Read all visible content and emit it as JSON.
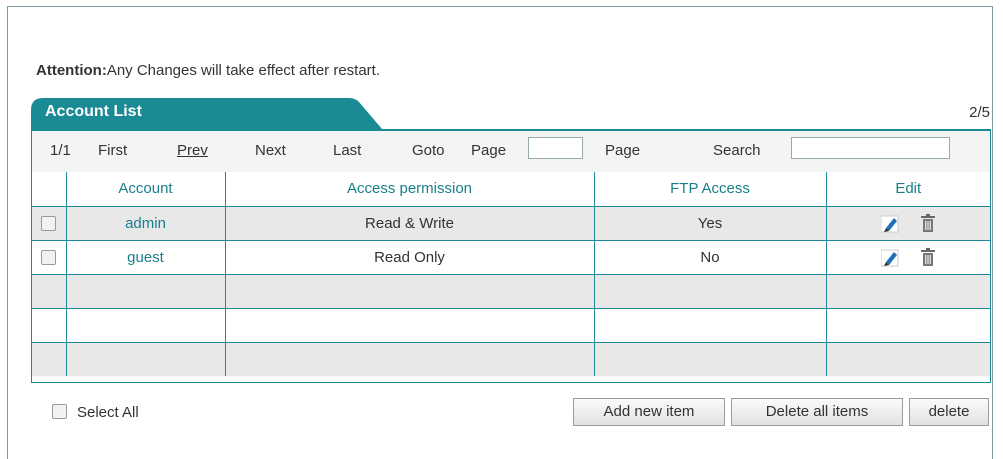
{
  "attention": {
    "label": "Attention:",
    "text": "Any Changes will take effect after restart."
  },
  "tab": {
    "title": "Account List",
    "page_count": "2/5"
  },
  "pager": {
    "current": "1/1",
    "first": "First",
    "prev": "Prev",
    "next": "Next",
    "last": "Last",
    "goto": "Goto",
    "page_label": "Page",
    "page_input_value": "",
    "page_suffix": "Page",
    "search_label": "Search",
    "search_value": ""
  },
  "table": {
    "headers": [
      "Account",
      "Access permission",
      "FTP Access",
      "Edit"
    ],
    "rows": [
      {
        "account": "admin",
        "permission": "Read & Write",
        "ftp": "Yes"
      },
      {
        "account": "guest",
        "permission": "Read Only",
        "ftp": "No"
      }
    ]
  },
  "footer": {
    "select_all": "Select All",
    "add_new": "Add new item",
    "delete_all": "Delete all items",
    "delete": "delete"
  },
  "colors": {
    "accent": "#1a8a94",
    "header_text": "#1a7f8a",
    "odd_row": "#e8e8e8"
  },
  "icons": {
    "edit": "pencil-icon",
    "delete": "trash-icon"
  }
}
